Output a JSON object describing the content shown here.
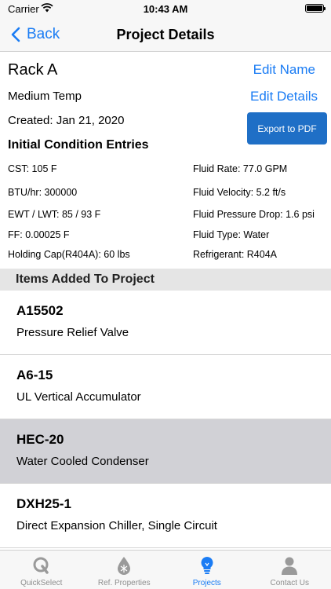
{
  "status_bar": {
    "carrier": "Carrier",
    "time": "10:43 AM"
  },
  "nav": {
    "back_label": "Back",
    "title": "Project Details"
  },
  "project": {
    "name": "Rack A",
    "edit_name_label": "Edit Name",
    "temp_type": "Medium Temp",
    "edit_details_label": "Edit Details",
    "created": "Created: Jan 21, 2020",
    "export_label": "Export to PDF"
  },
  "conditions": {
    "title": "Initial Condition Entries",
    "left": [
      "CST: 105 F",
      "BTU/hr: 300000",
      "EWT / LWT: 85 / 93 F",
      "FF: 0.00025 F",
      "Holding Cap(R404A): 60 lbs"
    ],
    "right": [
      "Fluid Rate: 77.0 GPM",
      "Fluid Velocity: 5.2 ft/s",
      "Fluid Pressure Drop: 1.6 psi",
      "Fluid Type: Water",
      "Refrigerant: R404A"
    ]
  },
  "items": {
    "header": "Items Added To Project",
    "rows": [
      {
        "code": "A15502",
        "description": "Pressure Relief Valve"
      },
      {
        "code": "A6-15",
        "description": "UL Vertical Accumulator"
      },
      {
        "code": "HEC-20",
        "description": "Water Cooled Condenser"
      },
      {
        "code": "DXH25-1",
        "description": "Direct Expansion Chiller, Single Circuit"
      }
    ]
  },
  "tabs": [
    {
      "label": "QuickSelect",
      "icon": "quickselect-icon"
    },
    {
      "label": "Ref. Properties",
      "icon": "drop-icon"
    },
    {
      "label": "Projects",
      "icon": "lightbulb-icon"
    },
    {
      "label": "Contact Us",
      "icon": "person-icon"
    }
  ],
  "colors": {
    "accent": "#1a7cf4",
    "export_button": "#1f6fc6",
    "selected_row": "#d1d1d6"
  }
}
